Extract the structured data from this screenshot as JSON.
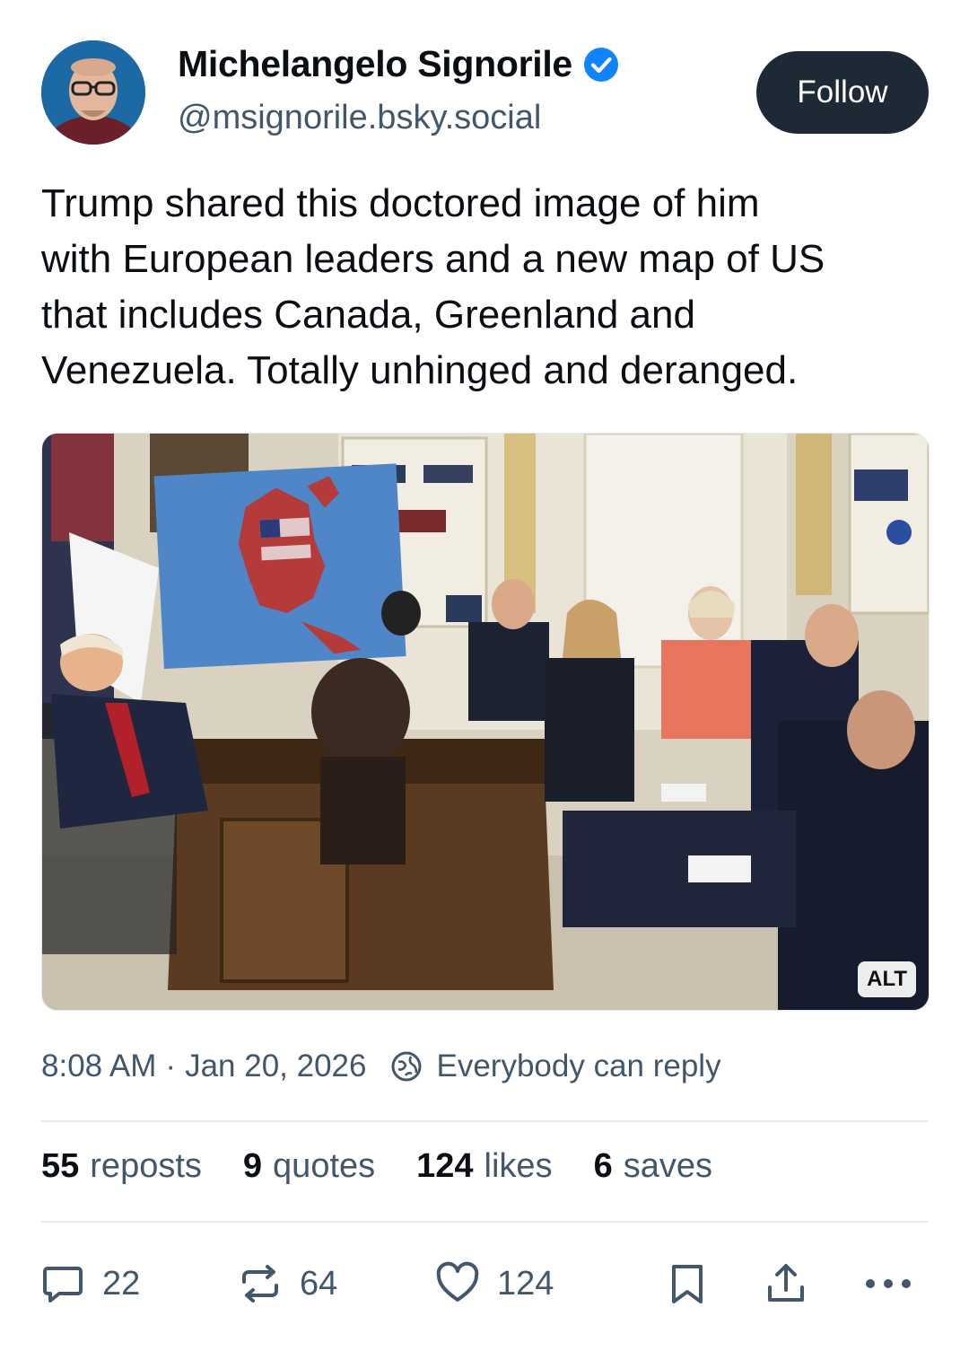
{
  "author": {
    "display_name": "Michelangelo Signorile",
    "handle": "@msignorile.bsky.social",
    "verified": true,
    "follow_label": "Follow"
  },
  "post": {
    "text_lines": [
      "Trump shared this doctored image of him",
      "with European leaders and a new map of US",
      "that includes Canada, Greenland and",
      "Venezuela. Totally unhinged and deranged."
    ],
    "image_alt_label": "ALT"
  },
  "meta": {
    "time": "8:08 AM",
    "separator": "·",
    "date": "Jan 20, 2026",
    "reply_setting": "Everybody can reply"
  },
  "stats": {
    "reposts_count": "55",
    "reposts_label": "reposts",
    "quotes_count": "9",
    "quotes_label": "quotes",
    "likes_count": "124",
    "likes_label": "likes",
    "saves_count": "6",
    "saves_label": "saves"
  },
  "actions": {
    "reply_count": "22",
    "repost_count": "64",
    "like_count": "124"
  },
  "colors": {
    "follow_button_bg": "#1e2936",
    "verified_blue": "#1083fe",
    "secondary_text": "#42576c"
  }
}
